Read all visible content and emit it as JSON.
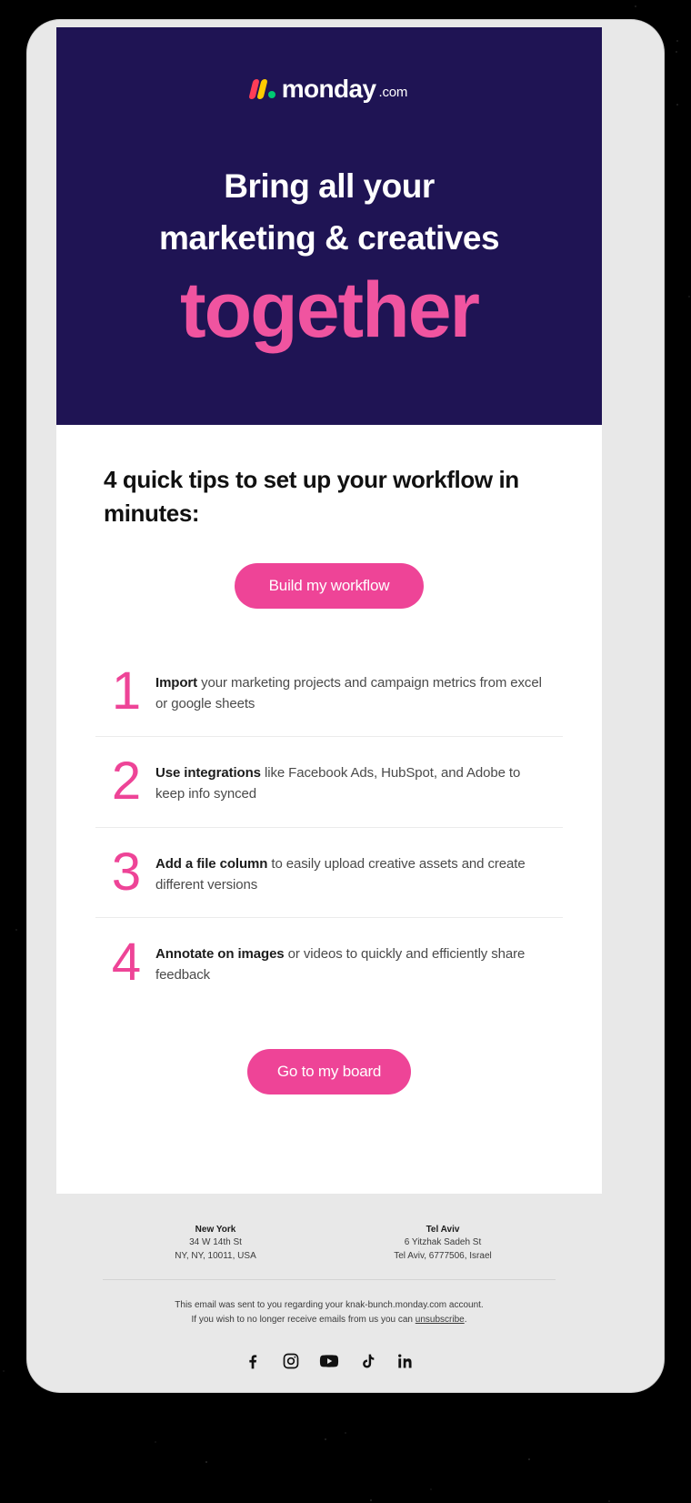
{
  "colors": {
    "hero_background": "#1f1454",
    "accent_pink": "#ee4497",
    "heading_pink": "#f054a0",
    "card_background": "#ffffff",
    "footer_background": "#e8e8e8",
    "logo_red": "#ff3d57",
    "logo_yellow": "#ffcb00",
    "logo_green": "#00ca72"
  },
  "hero": {
    "logo": {
      "brand": "monday",
      "suffix": ".com",
      "mark_names": [
        "logo-bar-red",
        "logo-bar-yellow",
        "logo-dot-green"
      ]
    },
    "heading_line_1": "Bring all your",
    "heading_line_2": "marketing & creatives",
    "heading_emphasis": "together"
  },
  "main": {
    "tips_heading": "4 quick tips to set up your workflow in minutes:",
    "cta_top_label": "Build my workflow",
    "cta_bottom_label": "Go to my board",
    "tips": [
      {
        "number": "1",
        "bold": "Import",
        "rest": " your marketing projects and campaign metrics from excel or google sheets"
      },
      {
        "number": "2",
        "bold": "Use integrations",
        "rest": " like Facebook Ads, HubSpot, and Adobe to keep info synced"
      },
      {
        "number": "3",
        "bold": "Add a file column",
        "rest": " to easily upload creative assets and create different versions"
      },
      {
        "number": "4",
        "bold": "Annotate on images",
        "rest": " or videos to quickly and efficiently share feedback"
      }
    ]
  },
  "footer": {
    "offices": [
      {
        "city": "New York",
        "street": "34 W 14th St",
        "region": "NY, NY, 10011, USA"
      },
      {
        "city": "Tel Aviv",
        "street": "6 Yitzhak Sadeh St",
        "region": "Tel Aviv, 6777506, Israel"
      }
    ],
    "legal_line_1": "This email was sent to you regarding your knak-bunch.monday.com account.",
    "legal_line_2_prefix": "If you wish to no longer receive emails from us you can ",
    "legal_unsubscribe": "unsubscribe",
    "legal_line_2_suffix": ".",
    "social": [
      {
        "name": "facebook-icon",
        "label": "Facebook"
      },
      {
        "name": "instagram-icon",
        "label": "Instagram"
      },
      {
        "name": "youtube-icon",
        "label": "YouTube"
      },
      {
        "name": "tiktok-icon",
        "label": "TikTok"
      },
      {
        "name": "linkedin-icon",
        "label": "LinkedIn"
      }
    ]
  }
}
